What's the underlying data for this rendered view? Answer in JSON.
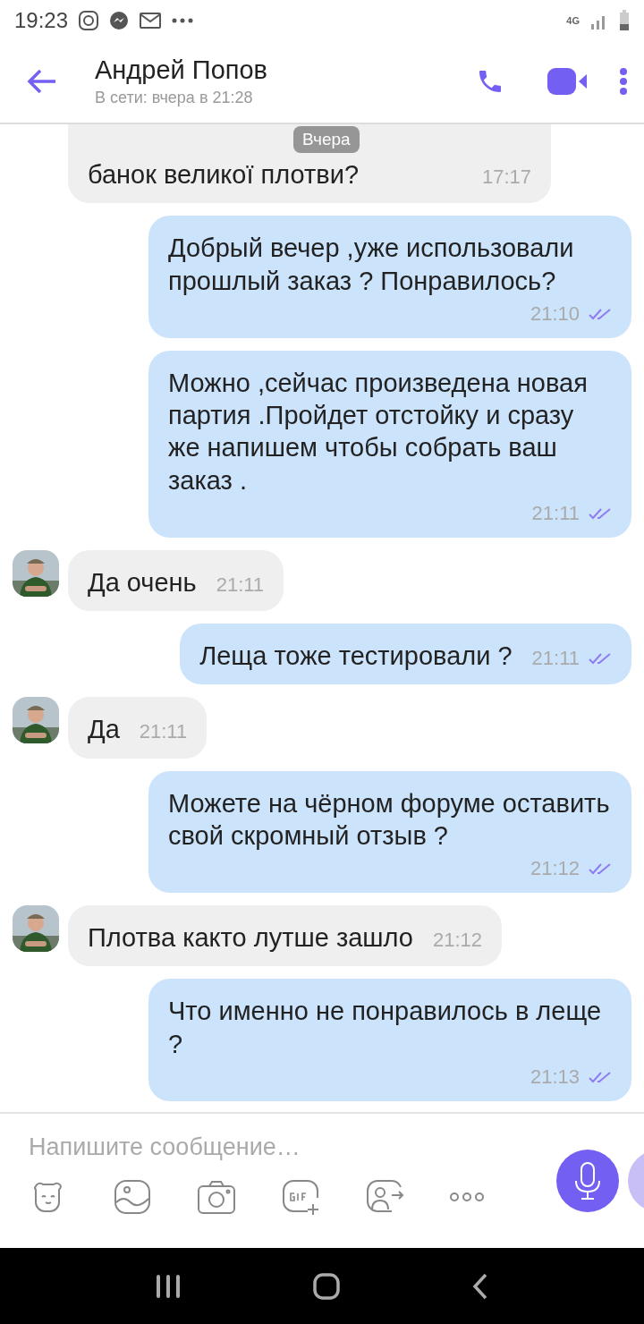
{
  "status_bar": {
    "time": "19:23",
    "network": "4G"
  },
  "header": {
    "title": "Андрей Попов",
    "subtitle": "В сети: вчера в 21:28"
  },
  "date_chip": "Вчера",
  "messages": [
    {
      "kind": "in",
      "avatar": false,
      "text": "банок великої плотви?",
      "time": "17:17"
    },
    {
      "kind": "out",
      "text": "Добрый вечер ,уже использовали прошлый заказ ? Понравилось?",
      "time": "21:10",
      "read": true
    },
    {
      "kind": "out",
      "text": "Можно ,сейчас произведена новая партия .Пройдет отстойку и сразу же  напишем чтобы собрать ваш заказ .",
      "time": "21:11",
      "read": true
    },
    {
      "kind": "in",
      "avatar": true,
      "text": "Да очень",
      "time": "21:11"
    },
    {
      "kind": "out",
      "text": "Леща тоже тестировали ?",
      "time": "21:11",
      "read": true
    },
    {
      "kind": "in",
      "avatar": true,
      "text": "Да",
      "time": "21:11"
    },
    {
      "kind": "out",
      "text": "Можете на чёрном форуме оставить свой скромный отзыв ?",
      "time": "21:12",
      "read": true
    },
    {
      "kind": "in",
      "avatar": true,
      "text": "Плотва както лутше зашло",
      "time": "21:12"
    },
    {
      "kind": "out",
      "text": "Что именно не понравилось в леще ?",
      "time": "21:13",
      "read": true
    }
  ],
  "composer": {
    "placeholder": "Напишите сообщение…"
  }
}
